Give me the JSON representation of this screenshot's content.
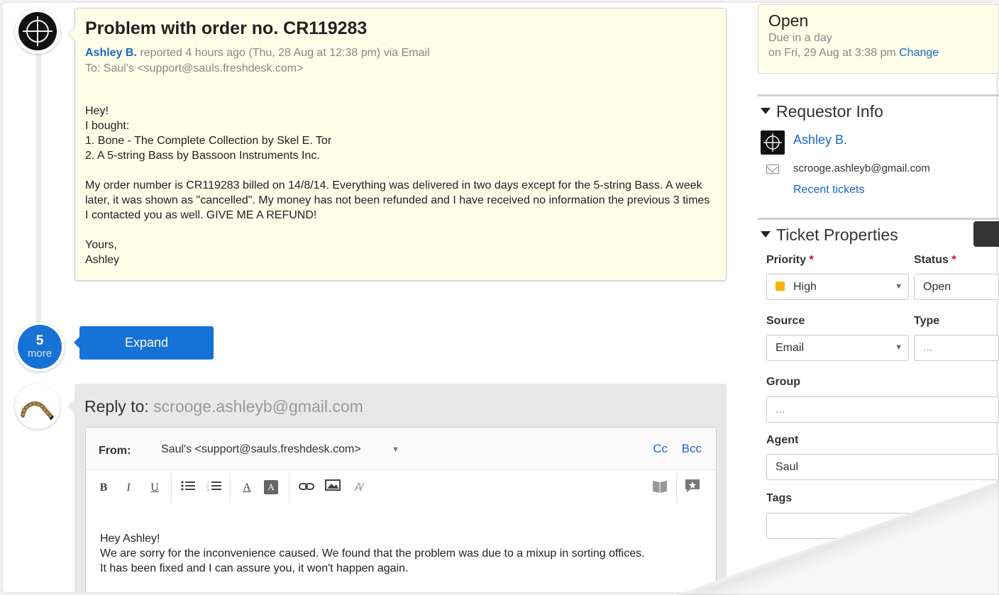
{
  "ticket": {
    "title": "Problem with order no. CR119283",
    "author": "Ashley B.",
    "meta": "reported 4 hours ago (Thu, 28 Aug at 12:38 pm) via Email",
    "to": "To: Saul's <support@sauls.freshdesk.com>",
    "body": {
      "greeting": "Hey!",
      "line1": "I bought:",
      "item1": "1. Bone - The Complete Collection by Skel E. Tor",
      "item2": "2. A 5-string Bass by Bassoon Instruments Inc.",
      "para": "My order number is CR119283 billed on 14/8/14. Everything was delivered in two days except for the 5-string Bass. A week later, it was shown as \"cancelled\". My money has not been refunded and I have received no information the previous 3 times I contacted you as well. GIVE ME A REFUND!",
      "signoff": "Yours,",
      "signature": "Ashley"
    }
  },
  "conversation": {
    "more_count": "5",
    "more_label": "more",
    "expand_label": "Expand"
  },
  "reply": {
    "label": "Reply to:",
    "address": "scrooge.ashleyb@gmail.com",
    "from_label": "From:",
    "from_value": "Saul's <support@sauls.freshdesk.com>",
    "cc": "Cc",
    "bcc": "Bcc",
    "toolbar": {
      "bold": "B",
      "italic": "I",
      "underline": "U",
      "font_color": "A",
      "bg_color": "A"
    },
    "body": {
      "greeting": "Hey Ashley!",
      "line1": "We are sorry for the inconvenience caused. We found that the problem was due to a mixup in sorting offices.",
      "line2": "It has been fixed and I can assure you, it won't happen again."
    }
  },
  "status": {
    "state": "Open",
    "due": "Due in a day",
    "due_date": "on Fri, 29 Aug at 3:38 pm",
    "change": "Change"
  },
  "requestor": {
    "title": "Requestor Info",
    "name": "Ashley B.",
    "email": "scrooge.ashleyb@gmail.com",
    "recent": "Recent tickets"
  },
  "properties": {
    "title": "Ticket Properties",
    "priority_label": "Priority",
    "priority_value": "High",
    "status_label": "Status",
    "status_value": "Open",
    "source_label": "Source",
    "source_value": "Email",
    "type_label": "Type",
    "type_value": "...",
    "group_label": "Group",
    "group_value": "...",
    "agent_label": "Agent",
    "agent_value": "Saul",
    "tags_label": "Tags",
    "required_mark": "*"
  },
  "colors": {
    "accent": "#1772d6",
    "link": "#1967c8",
    "note_bg": "#fefee9",
    "priority_high": "#f5b301"
  }
}
